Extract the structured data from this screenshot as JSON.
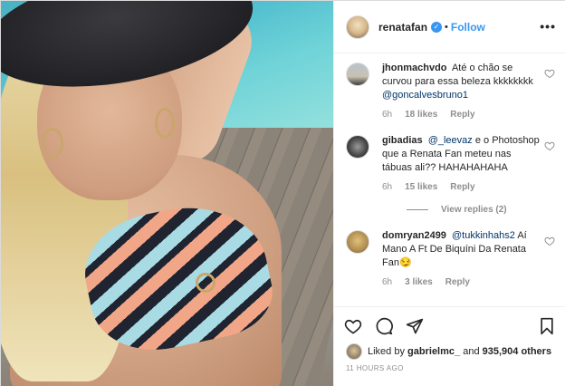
{
  "header": {
    "username": "renatafan",
    "separator": "•",
    "follow_label": "Follow",
    "more_icon": "ellipsis-icon"
  },
  "comments": [
    {
      "username": "jhonmachvdo",
      "text": "Até o chão se curvou para essa beleza kkkkkkkk",
      "mention": "@goncalvesbruno1",
      "time": "6h",
      "likes": "18 likes",
      "reply_label": "Reply"
    },
    {
      "username": "gibadias",
      "mention": "@_leevaz",
      "text": "e o Photoshop que a Renata Fan meteu nas tábuas ali?? HAHAHAHAHA",
      "time": "6h",
      "likes": "15 likes",
      "reply_label": "Reply",
      "view_replies": "View replies (2)"
    },
    {
      "username": "domryan2499",
      "mention": "@tukkinhahs2",
      "text": "Aí Mano A Ft De Biquíni Da Renata Fan😏",
      "time": "6h",
      "likes": "3 likes",
      "reply_label": "Reply"
    }
  ],
  "likes_line": {
    "prefix": "Liked by",
    "user": "gabrielmc_",
    "and": "and",
    "count": "935,904 others"
  },
  "timestamp": "11 HOURS AGO",
  "colors": {
    "accent": "#3897f0",
    "text": "#262626",
    "muted": "#8e8e8e"
  }
}
